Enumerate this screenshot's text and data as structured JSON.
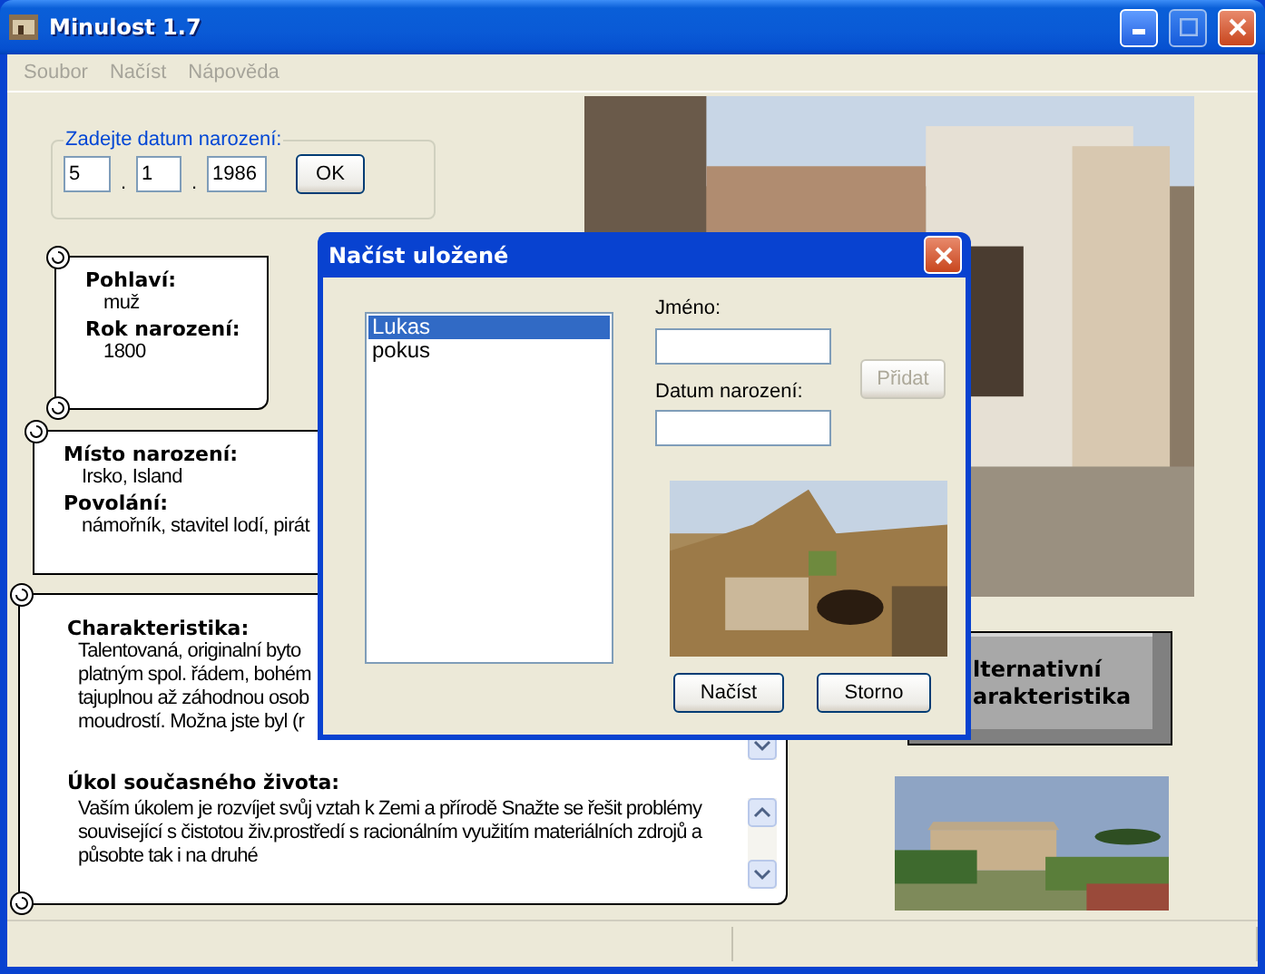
{
  "window": {
    "title": "Minulost 1.7"
  },
  "menu": [
    {
      "label": "Soubor",
      "disabled": true
    },
    {
      "label": "Načíst",
      "disabled": true
    },
    {
      "label": "Nápověda",
      "disabled": true
    }
  ],
  "birth_date": {
    "legend": "Zadejte datum narození:",
    "day": "5",
    "month": "1",
    "year": "1986",
    "separators": [
      ".",
      "."
    ],
    "ok_button": "OK"
  },
  "basic_info": [
    {
      "heading": "Pohlaví:",
      "value": "muž"
    },
    {
      "heading": "Rok narození:",
      "value": "1800"
    }
  ],
  "origin_info": [
    {
      "heading": "Místo narození:",
      "value": "Irsko, Island"
    },
    {
      "heading": "Povolání:",
      "value": "námořník, stavitel lodí, pirát"
    }
  ],
  "characteristics": {
    "heading": "Charakteristika:",
    "lines": [
      "Talentovaná, originalní byto",
      "platným spol. řádem, bohém",
      "tajuplnou až záhodnou osob",
      "moudrostí. Možna jste byl (r"
    ]
  },
  "life_task": {
    "heading": "Úkol současného života:",
    "text": "Vaším úkolem je rozvíjet svůj vztah k Zemi a přírodě Snažte se řešit problémy související s čistotou živ.prostředí s racionálním využitím materiálních zdrojů a působte tak i na druhé"
  },
  "alternative_button": {
    "lines": [
      "lternativní",
      "arakteristika"
    ]
  },
  "dialog": {
    "title": "Načíst uložené",
    "list": [
      {
        "label": "Lukas",
        "selected": true
      },
      {
        "label": "pokus",
        "selected": false
      }
    ],
    "name_label": "Jméno:",
    "date_label": "Datum narození:",
    "add_button": {
      "label": "Přidat",
      "disabled": true
    },
    "load_button": "Načíst",
    "cancel_button": "Storno"
  }
}
